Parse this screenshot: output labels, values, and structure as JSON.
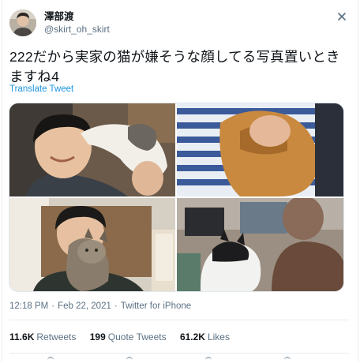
{
  "user": {
    "display_name": "澤部渡",
    "handle": "@skirt_oh_skirt"
  },
  "tweet": {
    "text": "222だから実家の猫が嫌そうな顔してる写真置いときますね4",
    "translate_label": "Translate Tweet"
  },
  "media": [
    {
      "label": "photo-1"
    },
    {
      "label": "photo-2"
    },
    {
      "label": "photo-3"
    },
    {
      "label": "photo-4"
    }
  ],
  "meta": {
    "time": "12:18 PM",
    "date": "Feb 22, 2021",
    "source": "Twitter for iPhone",
    "separator": "·"
  },
  "stats": {
    "retweets_count": "11.6K",
    "retweets_label": "Retweets",
    "quotes_count": "199",
    "quotes_label": "Quote Tweets",
    "likes_count": "61.2K",
    "likes_label": "Likes"
  },
  "icons": {
    "more": "more-icon"
  },
  "colors": {
    "link": "#1b95e0",
    "secondary_text": "#5b7083",
    "divider": "#e6ecf0"
  }
}
